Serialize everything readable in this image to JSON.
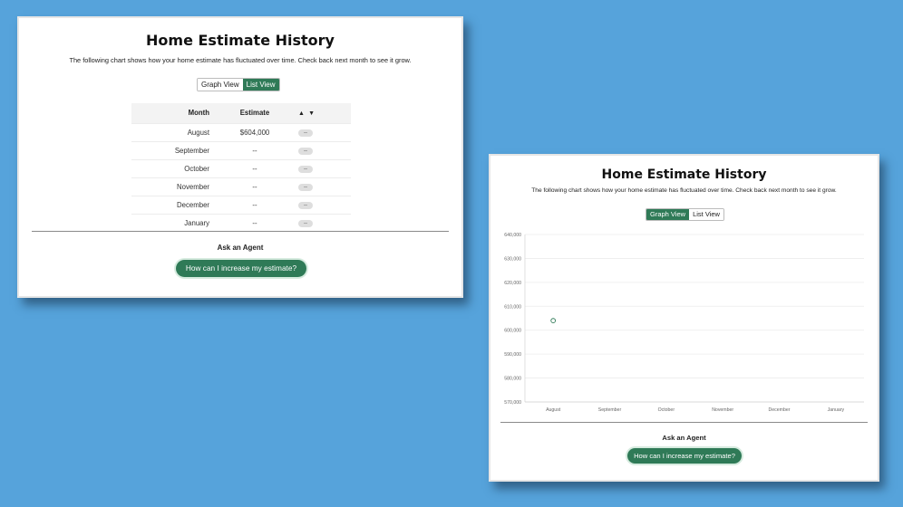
{
  "list_card": {
    "title": "Home Estimate History",
    "subtitle": "The following chart shows how your home estimate has fluctuated over time. Check back next month to see it grow.",
    "toggle": {
      "graph_label": "Graph View",
      "list_label": "List View",
      "active": "list"
    },
    "table": {
      "headers": {
        "month": "Month",
        "estimate": "Estimate",
        "sort_up": "▲",
        "sort_down": "▼"
      },
      "rows": [
        {
          "month": "August",
          "estimate": "$604,000",
          "change": "--"
        },
        {
          "month": "September",
          "estimate": "--",
          "change": "--"
        },
        {
          "month": "October",
          "estimate": "--",
          "change": "--"
        },
        {
          "month": "November",
          "estimate": "--",
          "change": "--"
        },
        {
          "month": "December",
          "estimate": "--",
          "change": "--"
        },
        {
          "month": "January",
          "estimate": "--",
          "change": "--"
        }
      ]
    },
    "ask_label": "Ask an Agent",
    "cta_label": "How can I increase my estimate?"
  },
  "graph_card": {
    "title": "Home Estimate History",
    "subtitle": "The following chart shows how your home estimate has fluctuated over time. Check back next month to see it grow.",
    "toggle": {
      "graph_label": "Graph View",
      "list_label": "List View",
      "active": "graph"
    },
    "ask_label": "Ask an Agent",
    "cta_label": "How can I increase my estimate?"
  },
  "colors": {
    "accent": "#2f7a57",
    "background": "#56a3db"
  },
  "chart_data": {
    "type": "scatter",
    "categories": [
      "August",
      "September",
      "October",
      "November",
      "December",
      "January"
    ],
    "values": [
      604000,
      null,
      null,
      null,
      null,
      null
    ],
    "y_ticks": [
      "640,000",
      "630,000",
      "620,000",
      "610,000",
      "600,000",
      "590,000",
      "580,000",
      "570,000"
    ],
    "ylim": [
      570000,
      640000
    ],
    "grid": true
  }
}
